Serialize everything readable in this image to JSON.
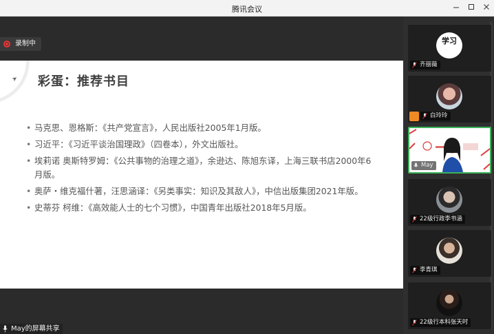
{
  "window": {
    "title": "腾讯会议"
  },
  "recording": {
    "label": "录制中"
  },
  "slide": {
    "title": "彩蛋：推荐书目",
    "books": [
      "马克思、恩格斯：《共产党宣言》，人民出版社2005年1月版。",
      "习近平：《习近平谈治国理政》（四卷本），外文出版社。",
      "埃莉诺 奥斯特罗姆：《公共事物的治理之道》，余逊达、陈旭东译，上海三联书店2000年6月版。",
      "奥萨・维克福什著，汪思涵译：《另类事实：知识及其敌人》，中信出版集团2021年版。",
      "史蒂芬 柯维：《高效能人士的七个习惯》，中国青年出版社2018年5月版。"
    ]
  },
  "share": {
    "label": "May的屏幕共享"
  },
  "participants": [
    {
      "name": "齐丽薇",
      "avatar_text": "学习"
    },
    {
      "name": "白玲玲"
    },
    {
      "name": "May"
    },
    {
      "name": "22级行政李书涵"
    },
    {
      "name": "李青琪"
    },
    {
      "name": "22级行本科张天时"
    }
  ],
  "colors": {
    "active_border": "#3cb35a",
    "record": "#e33333",
    "host_badge": "#f08a24"
  }
}
